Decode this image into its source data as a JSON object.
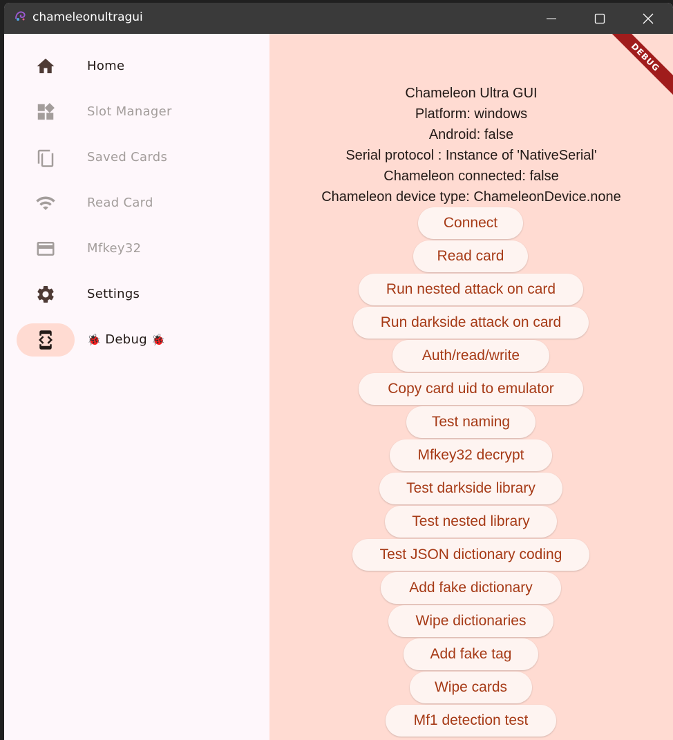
{
  "window": {
    "title": "chameleonultragui"
  },
  "sidebar": {
    "items": [
      {
        "label": "Home",
        "icon": "home-icon",
        "state": "enabled"
      },
      {
        "label": "Slot Manager",
        "icon": "widgets-icon",
        "state": "disabled"
      },
      {
        "label": "Saved Cards",
        "icon": "copy-icon",
        "state": "disabled"
      },
      {
        "label": "Read Card",
        "icon": "wifi-icon",
        "state": "disabled"
      },
      {
        "label": "Mfkey32",
        "icon": "credit-card-icon",
        "state": "disabled"
      },
      {
        "label": "Settings",
        "icon": "gear-icon",
        "state": "enabled"
      },
      {
        "label": "Debug",
        "icon": "developer-mode-icon",
        "state": "selected",
        "prefix": "🐞",
        "suffix": "🐞"
      }
    ]
  },
  "main": {
    "banner": "DEBUG",
    "info": [
      "Chameleon Ultra GUI",
      "Platform: windows",
      "Android: false",
      "Serial protocol : Instance of 'NativeSerial'",
      "Chameleon connected: false",
      "Chameleon device type: ChameleonDevice.none"
    ],
    "buttons": [
      "Connect",
      "Read card",
      "Run nested attack on card",
      "Run darkside attack on card",
      "Auth/read/write",
      "Copy card uid to emulator",
      "Test naming",
      "Mfkey32 decrypt",
      "Test darkside library",
      "Test nested library",
      "Test JSON dictionary coding",
      "Add fake dictionary",
      "Wipe dictionaries",
      "Add fake tag",
      "Wipe cards",
      "Mf1 detection test"
    ]
  },
  "colors": {
    "accent": "#a63a16",
    "content_bg": "#ffdbd2",
    "sidebar_bg": "#fef7fb",
    "titlebar_bg": "#3a3a3a",
    "button_bg": "#fef4f1"
  }
}
